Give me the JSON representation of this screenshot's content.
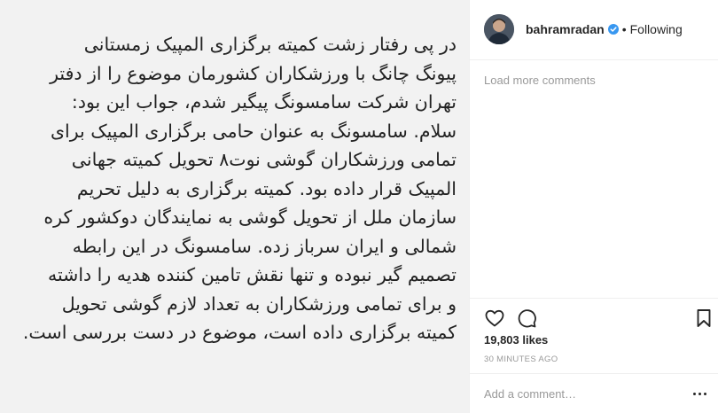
{
  "post": {
    "lines": [
      "در پی رفتار زشت کمیته برگزاری المپیک زمستانی",
      "پیونگ چانگ با ورزشکاران کشورمان موضوع را از دفتر",
      "تهران شرکت سامسونگ پیگیر شدم، جواب این بود:",
      "سلام. سامسونگ به عنوان حامی برگزاری المپیک برای",
      "تمامی ورزشکاران گوشی نوت۸ تحویل کمیته جهانی",
      "المپیک قرار داده بود. کمیته برگزاری به دلیل تحریم",
      "سازمان ملل از تحویل گوشی به نمایندگان دوکشور کره",
      "شمالی و ایران سرباز زده. سامسونگ در این رابطه",
      "تصمیم گیر نبوده و تنها نقش تامین کننده هدیه را داشته",
      "و برای تمامی ورزشکاران به تعداد لازم گوشی تحویل",
      "کمیته برگزاری داده است، موضوع در دست بررسی است."
    ]
  },
  "header": {
    "username": "bahramradan",
    "separator": "•",
    "follow_status": "Following"
  },
  "comments": {
    "load_more": "Load more comments"
  },
  "stats": {
    "likes": "19,803 likes",
    "time": "30 MINUTES AGO"
  },
  "comment_box": {
    "placeholder": "Add a comment…"
  },
  "colors": {
    "verified": "#3897f0",
    "text": "#262626",
    "muted": "#999999"
  }
}
